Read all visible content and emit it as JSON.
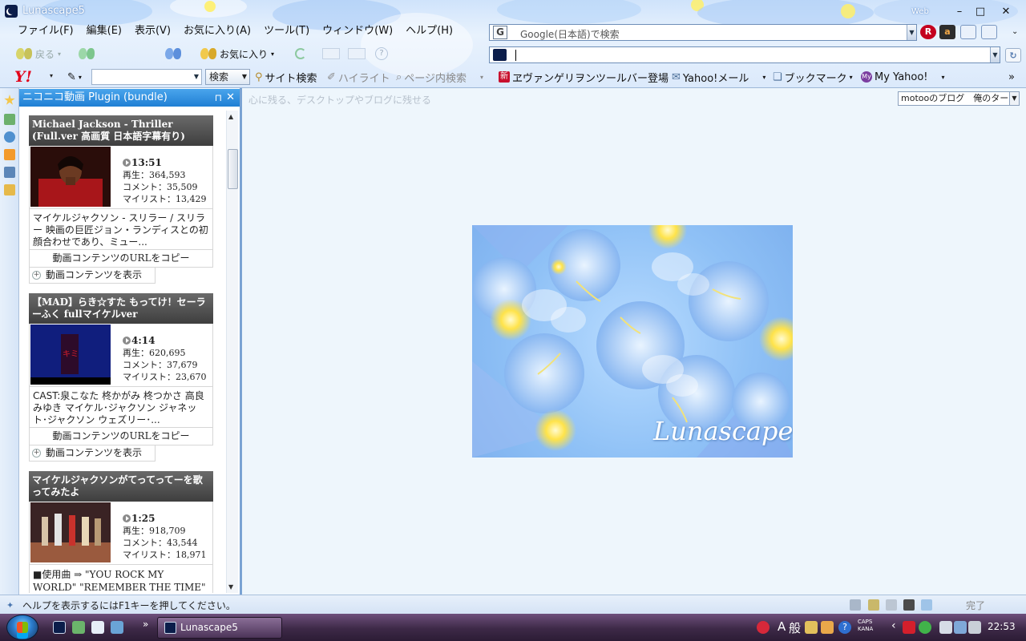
{
  "window": {
    "title": "Lunascape5",
    "web_label": "Web",
    "controls": {
      "minimize": "–",
      "maximize": "□",
      "close": "✕"
    }
  },
  "menu": [
    "ファイル(F)",
    "編集(E)",
    "表示(V)",
    "お気に入り(A)",
    "ツール(T)",
    "ウィンドウ(W)",
    "ヘルプ(H)"
  ],
  "nav": {
    "back": "戻る",
    "favorites": "お気に入り"
  },
  "search": {
    "engine_icon": "G",
    "placeholder": "Google(日本語)で検索",
    "rakuten": "R",
    "amazon": "a"
  },
  "toolbar": {
    "yahoo": "Y!",
    "search_button": "検索",
    "site_search": "サイト検索",
    "highlight": "ハイライト",
    "page_search": "ページ内検索",
    "news_badge": "新",
    "evangelion": "ヱヴァンゲリヲンツールバー登場",
    "yahoo_mail": "Yahoo!メール",
    "bookmark": "ブックマーク",
    "my_badge": "My",
    "my_yahoo": "My Yahoo!",
    "more": "»"
  },
  "panel": {
    "title": "ニコニコ動画 Plugin (bundle)",
    "pin": "⊓",
    "close": "✕",
    "videos": [
      {
        "title": "Michael Jackson - Thriller (Full.ver 高画質 日本語字幕有り)",
        "duration": "13:51",
        "plays": "再生：364,593",
        "comments": "コメント：35,509",
        "mylist": "マイリスト：13,429",
        "description": "マイケルジャクソン - スリラー / スリラー 映画の巨匠ジョン・ランディスとの初顔合わせであり、ミュー...",
        "copy_url": "動画コンテンツのURLをコピー",
        "show": "動画コンテンツを表示"
      },
      {
        "title": "【MAD】らき☆すた もってけ！セーラーふく fullマイケルver",
        "duration": "4:14",
        "plays": "再生：620,695",
        "comments": "コメント：37,679",
        "mylist": "マイリスト：23,670",
        "description": "CAST:泉こなた 柊かがみ 柊つかさ 高良みゆき マイケル･ジャクソン ジャネット･ジャクソン ウェズリー･...",
        "copy_url": "動画コンテンツのURLをコピー",
        "show": "動画コンテンツを表示"
      },
      {
        "title": "マイケルジャクソンがてってってーを歌ってみたよ",
        "duration": "1:25",
        "plays": "再生：918,709",
        "comments": "コメント：43,544",
        "mylist": "マイリスト：18,971",
        "description": "■使用曲 ⇒ \"YOU ROCK MY WORLD\" \"REMEMBER THE TIME\" \"TOWN"
      }
    ]
  },
  "content": {
    "hint": "心に残る、デスクトップやブログに残せる",
    "blog_select": "motooのブログ　俺のターン。",
    "splash_brand": "Lunascape"
  },
  "status": {
    "text": "ヘルプを表示するにはF1キーを押してください。",
    "done": "完了"
  },
  "taskbar": {
    "task": "Lunascape5",
    "expand": "»",
    "ime_a": "A",
    "ime_mode": "般",
    "caps": "CAPS",
    "kana": "KANA",
    "help": "?",
    "chevron": "‹",
    "clock": "22:53"
  }
}
